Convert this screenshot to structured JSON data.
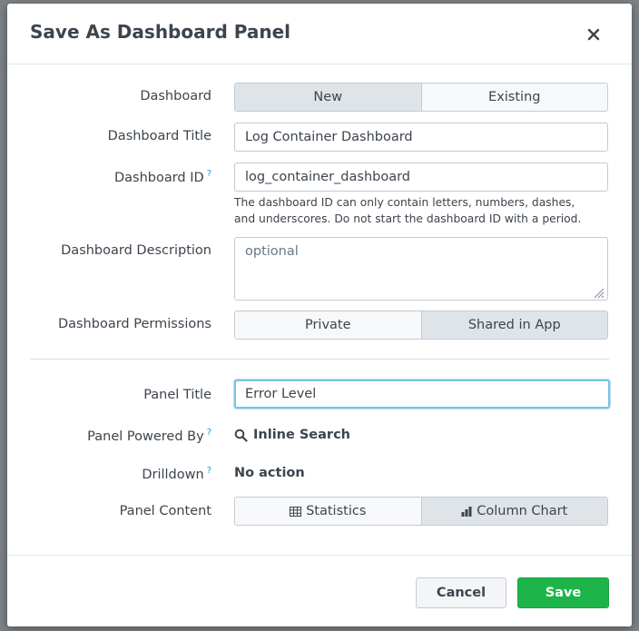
{
  "dialog": {
    "title": "Save As Dashboard Panel",
    "close_label": "×"
  },
  "form": {
    "dashboard": {
      "label": "Dashboard",
      "options": [
        "New",
        "Existing"
      ],
      "selected": "New"
    },
    "dashboard_title": {
      "label": "Dashboard Title",
      "value": "Log Container Dashboard"
    },
    "dashboard_id": {
      "label": "Dashboard ID",
      "help_mark": "?",
      "value": "log_container_dashboard",
      "help_line1": "The dashboard ID can only contain letters, numbers, dashes,",
      "help_line2": "and underscores. Do not start the dashboard ID with a period."
    },
    "dashboard_description": {
      "label": "Dashboard Description",
      "placeholder": "optional"
    },
    "dashboard_permissions": {
      "label": "Dashboard Permissions",
      "options": [
        "Private",
        "Shared in App"
      ],
      "selected": "Shared in App"
    },
    "panel_title": {
      "label": "Panel Title",
      "value": "Error Level"
    },
    "panel_powered_by": {
      "label": "Panel Powered By",
      "help_mark": "?",
      "value": "Inline Search",
      "icon": "search-icon"
    },
    "drilldown": {
      "label": "Drilldown",
      "help_mark": "?",
      "value": "No action"
    },
    "panel_content": {
      "label": "Panel Content",
      "options": [
        {
          "label": "Statistics",
          "icon": "table-icon"
        },
        {
          "label": "Column Chart",
          "icon": "bar-chart-icon"
        }
      ],
      "selected": "Column Chart"
    }
  },
  "footer": {
    "cancel_label": "Cancel",
    "save_label": "Save"
  },
  "colors": {
    "accent_help": "#1a9cd3",
    "primary_button": "#1db549",
    "focus_ring": "#7cc2e3",
    "text": "#3c444d"
  }
}
